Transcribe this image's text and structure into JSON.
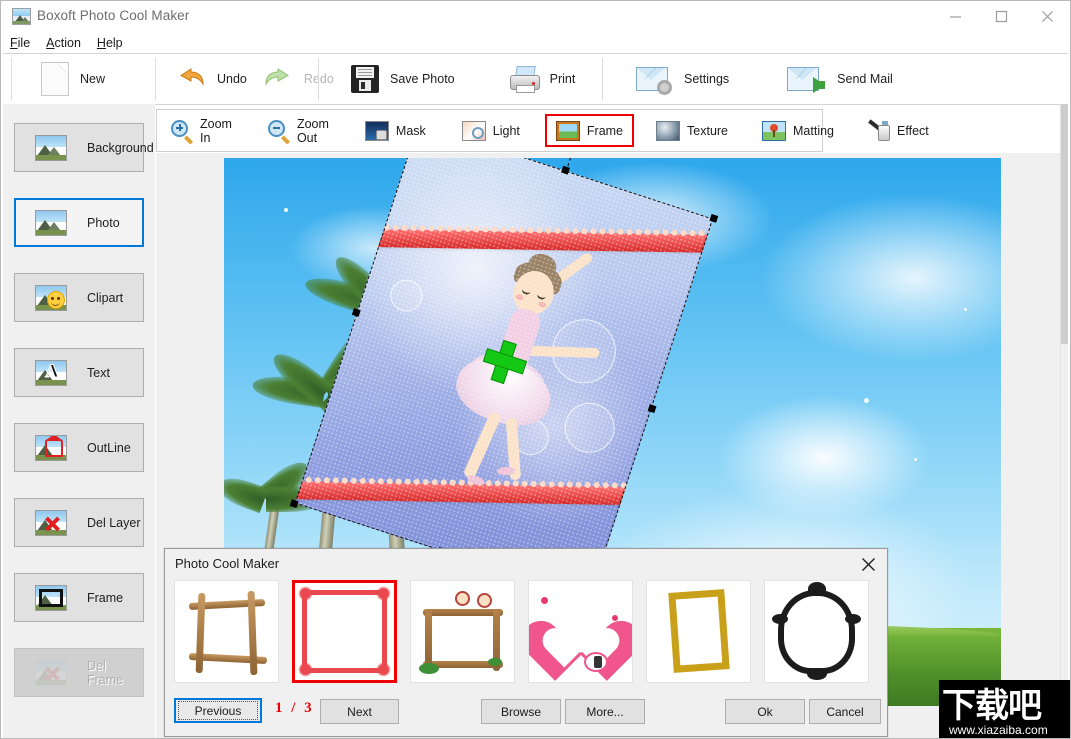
{
  "window": {
    "title": "Boxoft Photo Cool Maker",
    "app_icon": "photo-app-icon",
    "minimize": "minimize-icon",
    "maximize": "maximize-icon",
    "close": "close-icon"
  },
  "menu": [
    {
      "mnemonic": "F",
      "rest": "ile"
    },
    {
      "mnemonic": "A",
      "rest": "ction"
    },
    {
      "mnemonic": "H",
      "rest": "elp"
    }
  ],
  "toolbar": {
    "items": [
      {
        "label": "New",
        "icon": "new-page-icon",
        "enabled": true
      },
      {
        "label": "Undo",
        "icon": "undo-arrow-icon",
        "enabled": true
      },
      {
        "label": "Redo",
        "icon": "redo-arrow-icon",
        "enabled": false
      },
      {
        "label": "Save Photo",
        "icon": "floppy-disk-icon",
        "enabled": true
      },
      {
        "label": "Print",
        "icon": "printer-icon",
        "enabled": true
      },
      {
        "label": "Settings",
        "icon": "envelope-gear-icon",
        "enabled": true
      },
      {
        "label": "Send Mail",
        "icon": "envelope-arrow-icon",
        "enabled": true
      }
    ]
  },
  "sidebar": {
    "items": [
      {
        "label": "Background",
        "icon": "picture-icon",
        "selected": false,
        "enabled": true
      },
      {
        "label": "Photo",
        "icon": "picture-icon",
        "selected": true,
        "enabled": true
      },
      {
        "label": "Clipart",
        "icon": "smiley-picture-icon",
        "selected": false,
        "enabled": true
      },
      {
        "label": "Text",
        "icon": "letter-a-picture-icon",
        "selected": false,
        "enabled": true
      },
      {
        "label": "OutLine",
        "icon": "outline-picture-icon",
        "selected": false,
        "enabled": true
      },
      {
        "label": "Del Layer",
        "icon": "delete-layer-icon",
        "selected": false,
        "enabled": true
      },
      {
        "label": "Frame",
        "icon": "frame-picture-icon",
        "selected": false,
        "enabled": true
      },
      {
        "label": "Del Frame",
        "icon": "delete-frame-icon",
        "selected": false,
        "enabled": false
      }
    ]
  },
  "modebar": {
    "items": [
      {
        "label": "Zoom In",
        "icon": "magnifier-plus-icon",
        "active": false
      },
      {
        "label": "Zoom Out",
        "icon": "magnifier-minus-icon",
        "active": false
      },
      {
        "label": "Mask",
        "icon": "mask-icon",
        "active": false
      },
      {
        "label": "Light",
        "icon": "light-icon",
        "active": false
      },
      {
        "label": "Frame",
        "icon": "frame-icon",
        "active": true
      },
      {
        "label": "Texture",
        "icon": "texture-sphere-icon",
        "active": false
      },
      {
        "label": "Matting",
        "icon": "matting-icon",
        "active": false
      },
      {
        "label": "Effect",
        "icon": "brush-effect-icon",
        "active": false
      }
    ],
    "active_highlight_color": "#ee0000"
  },
  "canvas": {
    "description": "sky-with-clouds-and-palm-trees-background",
    "selected_layer": "ballerina-photo",
    "rotation_handle": "green-rotate-handle",
    "move_handle": "green-move-cross",
    "handles": "black-square-resize-handles"
  },
  "dialog": {
    "title": "Photo Cool Maker",
    "close_icon": "close-icon",
    "thumbnails": [
      {
        "name": "wooden-sticks-frame",
        "selected": false
      },
      {
        "name": "red-decorative-frame",
        "selected": true
      },
      {
        "name": "kids-wooden-frame",
        "selected": false
      },
      {
        "name": "pink-heart-frame",
        "selected": false
      },
      {
        "name": "gold-rectangle-frame",
        "selected": false
      },
      {
        "name": "black-ornate-frame",
        "selected": false
      }
    ],
    "buttons": {
      "previous": "Previous",
      "next": "Next",
      "browse": "Browse",
      "more": "More...",
      "ok": "Ok",
      "cancel": "Cancel"
    },
    "page_current": "1",
    "page_separator": "/",
    "page_total": "3",
    "page_color": "#ee0000",
    "selection_color": "#ee0000",
    "focus_color": "#0078d7"
  },
  "watermark": {
    "text_cn": "下载吧",
    "url": "www.xiazaiba.com"
  }
}
